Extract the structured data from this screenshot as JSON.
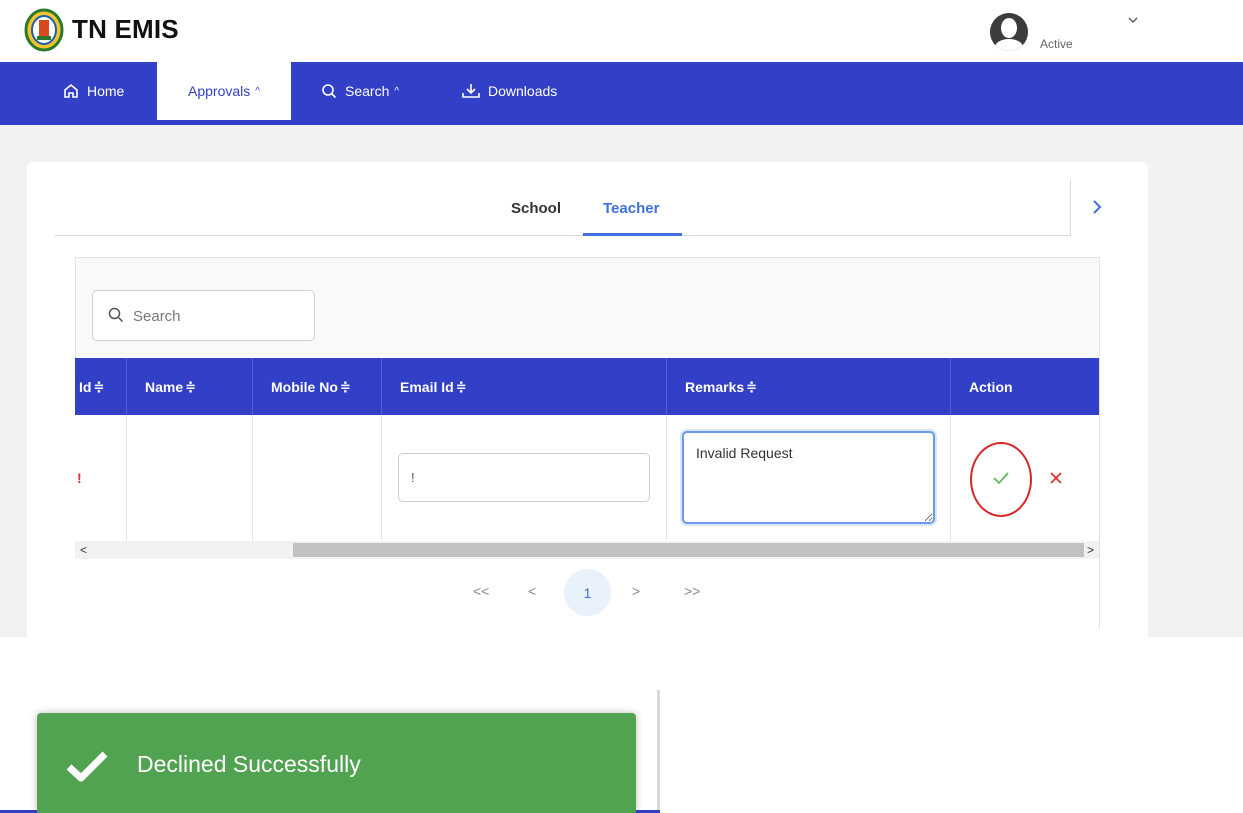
{
  "header": {
    "brand": "TN EMIS",
    "user_status": "Active"
  },
  "nav": {
    "home": "Home",
    "approvals": "Approvals",
    "search": "Search",
    "downloads": "Downloads",
    "caret": "^"
  },
  "tabs": {
    "school": "School",
    "teacher": "Teacher",
    "active": "Teacher"
  },
  "search": {
    "placeholder": "Search"
  },
  "table": {
    "sort_glyph": "≑",
    "columns": [
      "Id",
      "Name",
      "Mobile No",
      "Email Id",
      "Remarks",
      "Action"
    ],
    "rows": [
      {
        "id": "!",
        "name": "",
        "mobile": "",
        "email": "!",
        "remarks": "Invalid Request"
      }
    ]
  },
  "scroll": {
    "left": "<",
    "right": ">"
  },
  "pagination": {
    "first": "<<",
    "prev": "<",
    "current": "1",
    "next": ">",
    "last": ">>"
  },
  "toast": {
    "message": "Declined Successfully"
  },
  "colors": {
    "brand_blue": "#3240c7",
    "accent_blue": "#3f6fe0",
    "success_green": "#51a351",
    "danger_red": "#d62828"
  }
}
